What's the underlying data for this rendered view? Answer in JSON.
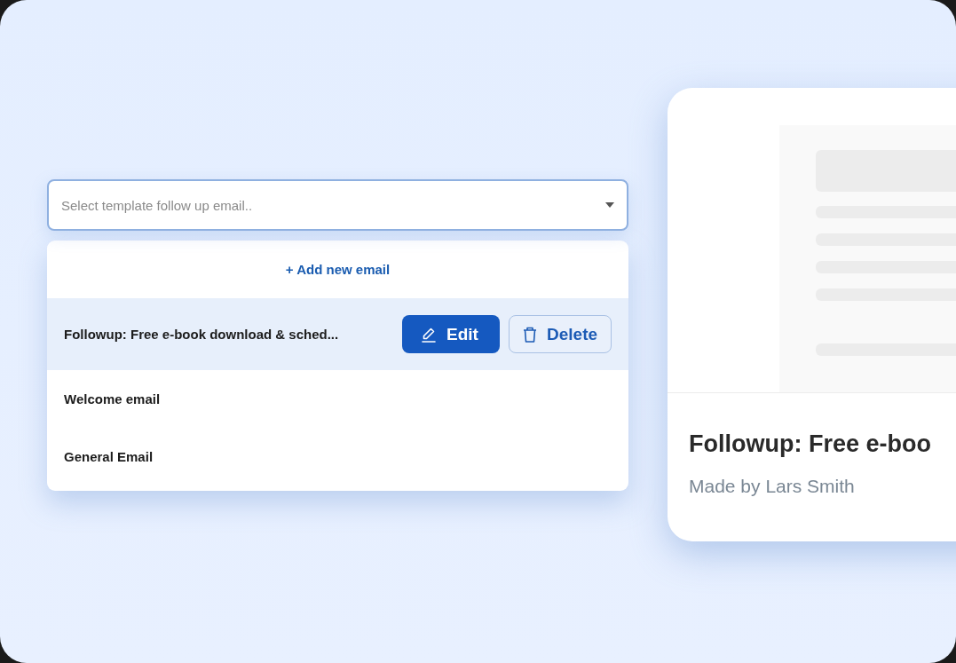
{
  "select": {
    "placeholder": "Select template follow up email.."
  },
  "menu": {
    "add_label": "+ Add new email",
    "items": [
      {
        "label": "Followup: Free e-book download & sched...",
        "selected": true,
        "actions": [
          {
            "kind": "edit",
            "label": "Edit"
          },
          {
            "kind": "delete",
            "label": "Delete"
          }
        ]
      },
      {
        "label": "Welcome email",
        "selected": false
      },
      {
        "label": "General Email",
        "selected": false
      }
    ]
  },
  "preview": {
    "title": "Followup: Free e-boo",
    "author": "Made by Lars Smith"
  }
}
